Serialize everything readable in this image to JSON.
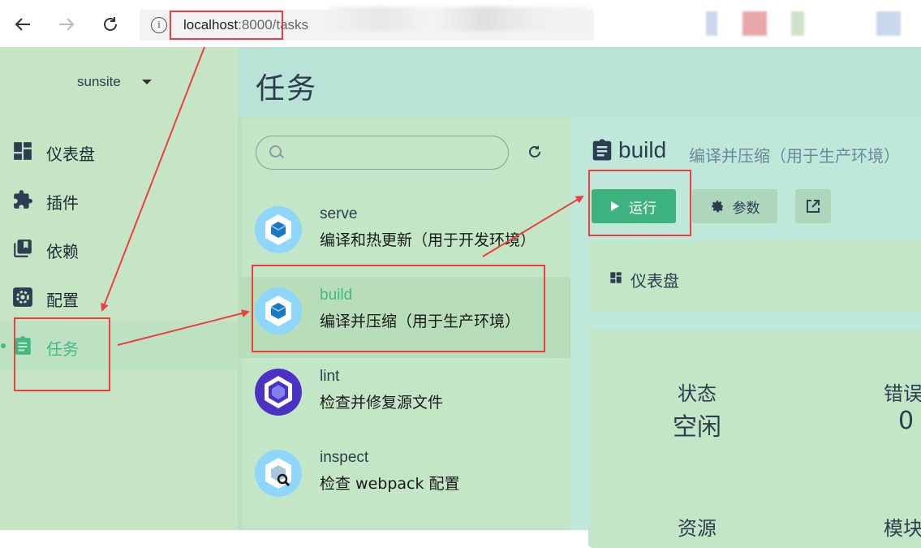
{
  "browser": {
    "url_host": "localhost",
    "url_port": ":8000",
    "url_path": "/tasks"
  },
  "sidebar": {
    "project": "sunsite",
    "items": [
      {
        "label": "仪表盘",
        "icon": "dashboard-icon"
      },
      {
        "label": "插件",
        "icon": "puzzle-icon"
      },
      {
        "label": "依赖",
        "icon": "library-icon"
      },
      {
        "label": "配置",
        "icon": "gear-icon"
      },
      {
        "label": "任务",
        "icon": "clipboard-icon",
        "active": true
      }
    ]
  },
  "header": {
    "title": "任务"
  },
  "search": {
    "placeholder": ""
  },
  "tasks": [
    {
      "name": "serve",
      "desc": "编译和热更新（用于开发环境）",
      "icon": "webpack-icon"
    },
    {
      "name": "build",
      "desc": "编译并压缩（用于生产环境）",
      "icon": "webpack-icon",
      "active": true
    },
    {
      "name": "lint",
      "desc": "检查并修复源文件",
      "icon": "eslint-icon"
    },
    {
      "name": "inspect",
      "desc": "检查 webpack 配置",
      "icon": "webpack-inspect-icon"
    }
  ],
  "detail": {
    "name": "build",
    "description": "编译并压缩（用于生产环境）",
    "run_label": "运行",
    "params_label": "参数",
    "dashboard_label": "仪表盘",
    "stats": [
      {
        "label": "状态",
        "value": "空闲"
      },
      {
        "label": "错误",
        "value": "0"
      },
      {
        "label": "资源",
        "value": ""
      },
      {
        "label": "模块",
        "value": ""
      }
    ]
  },
  "colors": {
    "accent": "#42b983",
    "sidebar_bg": "#c5e5c5",
    "header_bg": "#b9e3d6",
    "annotation": "#f03e3e"
  }
}
